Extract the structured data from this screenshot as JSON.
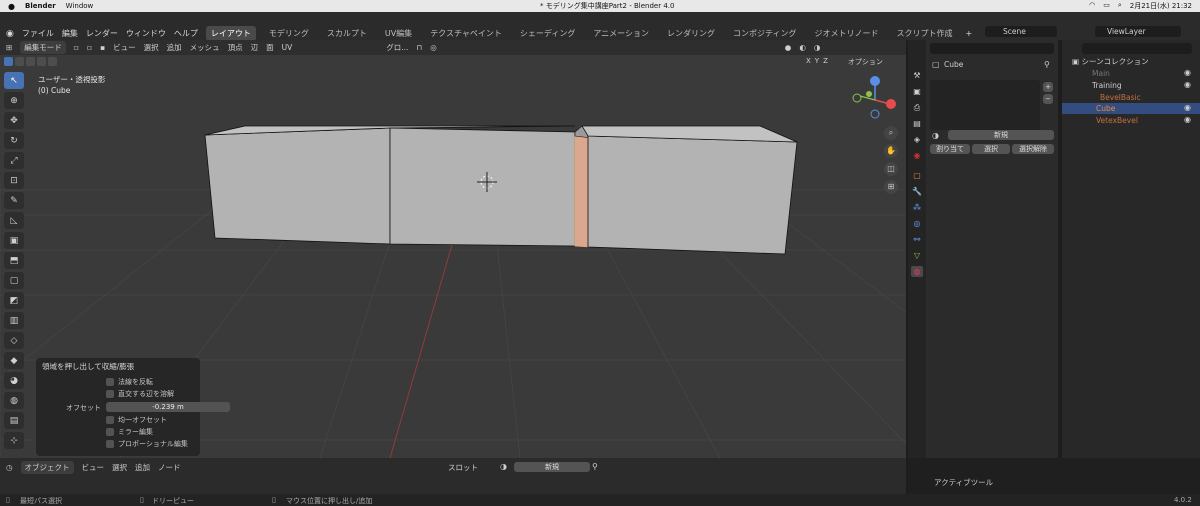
{
  "macbar": {
    "apple": "",
    "app_name": "Blender",
    "menu_window": "Window",
    "window_title": "* モデリング集中講座Part2 - Blender 4.0",
    "clock": "2月21日(水)  21:32",
    "icons": [
      "ai-icon",
      "wifi-icon",
      "battery-icon",
      "search-icon"
    ]
  },
  "app_menu": {
    "logo": "blender-logo",
    "items": [
      "ファイル",
      "編集",
      "レンダー",
      "ウィンドウ",
      "ヘルプ"
    ],
    "tabs": [
      "レイアウト",
      "モデリング",
      "スカルプト",
      "UV編集",
      "テクスチャペイント",
      "シェーディング",
      "アニメーション",
      "レンダリング",
      "コンポジティング",
      "ジオメトリノード",
      "スクリプト作成"
    ],
    "active_tab": "レイアウト",
    "add_tab": "+",
    "scene_label": "Scene",
    "viewlayer_label": "ViewLayer"
  },
  "viewport_header": {
    "mode": "編集モード",
    "menus": [
      "ビュー",
      "選択",
      "追加",
      "メッシュ",
      "頂点",
      "辺",
      "面",
      "UV"
    ],
    "transform": "グロ...",
    "options": "オプション",
    "axes": [
      "X",
      "Y",
      "Z"
    ]
  },
  "viewport_info": {
    "line1": "ユーザー・透視投影",
    "line2": "(0) Cube"
  },
  "operator_panel": {
    "title": "領域を押し出して収縮/膨張",
    "flip_normals": "法線を反転",
    "dissolve": "直交する辺を溶解",
    "offset_label": "オフセット",
    "offset_value": "-0.239 m",
    "even_offset": "均一オフセット",
    "mirror": "ミラー編集",
    "proportional": "プロポーショナル編集"
  },
  "properties": {
    "object_name": "Cube",
    "new_button": "新規",
    "assign": "割り当て",
    "select": "選択",
    "deselect": "選択解除",
    "add": "+",
    "remove": "−"
  },
  "outliner": {
    "root": "シーンコレクション",
    "rows": [
      {
        "name": "Main"
      },
      {
        "name": "Training"
      },
      {
        "name": "BevelBasic"
      },
      {
        "name": "Cube"
      },
      {
        "name": "VetexBevel"
      }
    ]
  },
  "timeline": {
    "mode": "オブジェクト",
    "menus": [
      "ビュー",
      "選択",
      "追加",
      "ノード"
    ],
    "slot": "スロット",
    "new_button": "新規",
    "add": "+",
    "active_tool": "アクティブツール"
  },
  "status_bar": {
    "left": "最短パス選択",
    "middle": "ドリーピュー",
    "right": "マウス位置に押し出し/追加",
    "version": "4.0.2"
  },
  "colors": {
    "accent": "#4772b3",
    "viewport_bg": "#3a3a3a",
    "cube_face": "#b0b0b0",
    "selected_face": "#d9a88e"
  }
}
